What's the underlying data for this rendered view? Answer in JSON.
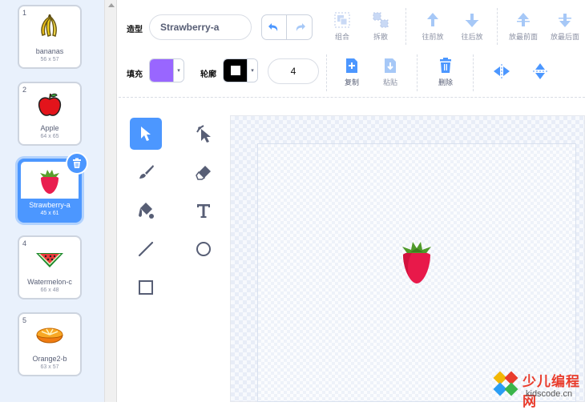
{
  "costumes": [
    {
      "number": "1",
      "name": "bananas",
      "size": "56 x 57",
      "icon": "banana-icon"
    },
    {
      "number": "2",
      "name": "Apple",
      "size": "64 x 65",
      "icon": "apple-icon"
    },
    {
      "number": "3",
      "name": "Strawberry-a",
      "size": "45 x 61",
      "icon": "strawberry-icon",
      "selected": true
    },
    {
      "number": "4",
      "name": "Watermelon-c",
      "size": "66 x 48",
      "icon": "watermelon-icon"
    },
    {
      "number": "5",
      "name": "Orange2-b",
      "size": "63 x 57",
      "icon": "orange-icon"
    }
  ],
  "toolbar": {
    "costume_label": "造型",
    "costume_name": "Strawberry-a",
    "fill_label": "填充",
    "outline_label": "轮廓",
    "fill_color": "#9966ff",
    "outline_color": "#000000",
    "stroke_width": "4",
    "group": "组合",
    "ungroup": "拆散",
    "forward": "往前放",
    "backward": "往后放",
    "front": "放最前面",
    "back": "放最后面",
    "copy": "复制",
    "paste": "粘贴",
    "delete": "删除"
  },
  "watermark": {
    "title": "少儿编程网",
    "url": "kidscode.cn"
  },
  "colors": {
    "accent": "#4c97ff",
    "fill": "#9966ff"
  }
}
